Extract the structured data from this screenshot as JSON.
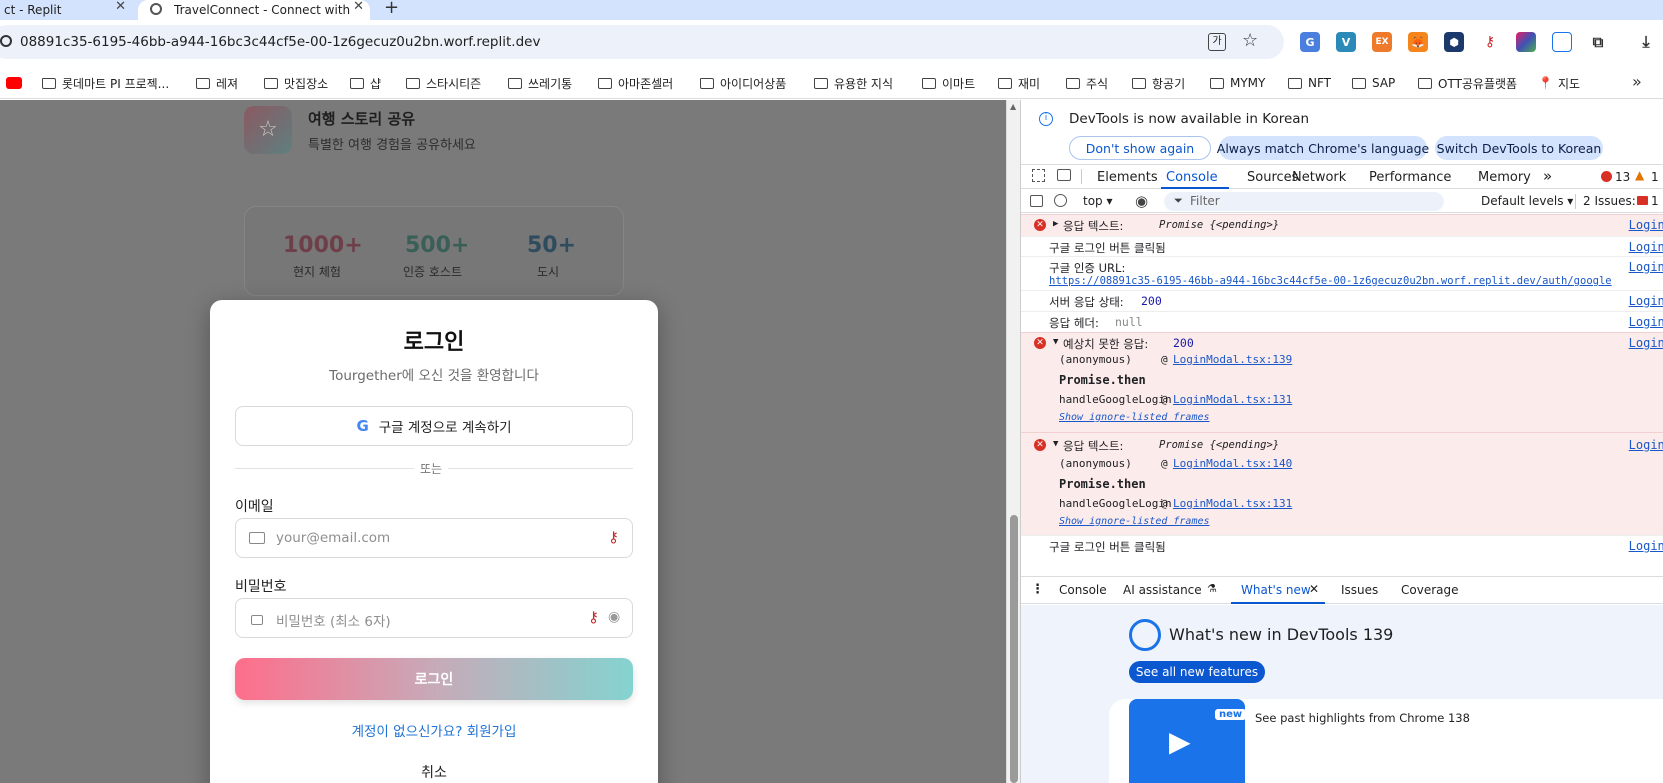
{
  "tabs": [
    {
      "title": "ct - Replit"
    },
    {
      "title": "TravelConnect - Connect with"
    }
  ],
  "new_tab_symbol": "+",
  "address_bar": {
    "url": "08891c35-6195-46bb-a944-16bc3c44cf5e-00-1z6gecuz0u2bn.worf.replit.dev"
  },
  "bookmarks": [
    "롯데마트 PI 프로젝...",
    "레져",
    "맛집장소",
    "샵",
    "스타시티즌",
    "쓰레기통",
    "아마존셀러",
    "아이디어상품",
    "유용한 지식",
    "이마트",
    "재미",
    "주식",
    "항공기",
    "MYMY",
    "NFT",
    "SAP",
    "OTT공유플랫폼",
    "지도"
  ],
  "page": {
    "feature_card": {
      "title": "여행 스토리 공유",
      "subtitle": "특별한 여행 경험을 공유하세요"
    },
    "stats": [
      {
        "value": "1000+",
        "label": "현지 체험",
        "color": "#e2506f"
      },
      {
        "value": "500+",
        "label": "인증 호스트",
        "color": "#3b9e87"
      },
      {
        "value": "50+",
        "label": "도시",
        "color": "#1f6f9e"
      }
    ],
    "login_modal": {
      "title": "로그인",
      "subtitle": "Tourgether에 오신 것을 환영합니다",
      "google_button": "구글 계정으로 계속하기",
      "divider": "또는",
      "email_label": "이메일",
      "email_placeholder": "your@email.com",
      "password_label": "비밀번호",
      "password_placeholder": "비밀번호 (최소 6자)",
      "login_button": "로그인",
      "signup_link": "계정이 없으신가요? 회원가입",
      "cancel": "취소"
    }
  },
  "devtools": {
    "banner": {
      "text": "DevTools is now available in Korean",
      "buttons": [
        "Don't show again",
        "Always match Chrome's language",
        "Switch DevTools to Korean"
      ]
    },
    "panel_tabs": [
      "Elements",
      "Console",
      "Sources",
      "Network",
      "Performance",
      "Memory"
    ],
    "active_tab": "Console",
    "error_count": "13",
    "warning_count": "1",
    "console_toolbar": {
      "context": "top",
      "filter_placeholder": "Filter",
      "levels": "Default levels",
      "issues": "2 Issues:",
      "issues_count": "1"
    },
    "console_messages": [
      {
        "text": "응답 텍스트:",
        "detail": "Promise {<pending>}",
        "source": "LoginM"
      },
      {
        "text": "구글 로그인 버튼 클릭됨",
        "source": "LoginM"
      },
      {
        "text": "구글 인증 URL:",
        "link": "https://08891c35-6195-46bb-a944-16bc3c44cf5e-00-1z6gecuz0u2bn.worf.replit.dev/auth/google",
        "source": "LoginM"
      },
      {
        "text": "서버 응답 상태:",
        "value": "200",
        "source": "LoginM"
      },
      {
        "text": "응답 헤더:",
        "value": "null",
        "source": "LoginM"
      },
      {
        "text": "예상치 못한 응답:",
        "value": "200",
        "source": "LoginM",
        "stack": [
          {
            "fn": "(anonymous)",
            "at": "@",
            "file": "LoginModal.tsx:139"
          },
          {
            "fn": "Promise.then"
          },
          {
            "fn": "handleGoogleLogin",
            "at": "@",
            "file": "LoginModal.tsx:131"
          },
          {
            "fn": "Show ignore-listed frames"
          }
        ]
      },
      {
        "text": "응답 텍스트:",
        "detail": "Promise {<pending>}",
        "source": "LoginM",
        "stack": [
          {
            "fn": "(anonymous)",
            "at": "@",
            "file": "LoginModal.tsx:140"
          },
          {
            "fn": "Promise.then"
          },
          {
            "fn": "handleGoogleLogin",
            "at": "@",
            "file": "LoginModal.tsx:131"
          },
          {
            "fn": "Show ignore-listed frames"
          }
        ]
      },
      {
        "text": "구글 로그인 버튼 클릭됨",
        "source": "LoginM"
      }
    ],
    "drawer_tabs": [
      "Console",
      "AI assistance",
      "What's new",
      "Issues",
      "Coverage"
    ],
    "active_drawer_tab": "What's new",
    "whats_new": {
      "title": "What's new in DevTools 139",
      "button": "See all new features",
      "card_badge": "new",
      "card_text": "See past highlights from Chrome 138"
    }
  }
}
